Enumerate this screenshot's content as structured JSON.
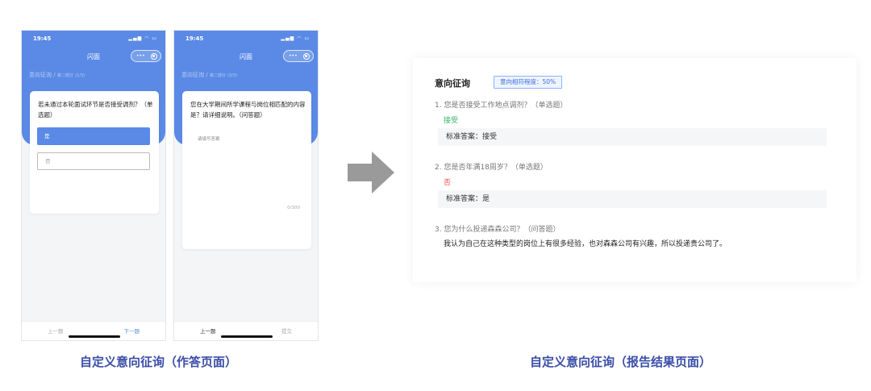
{
  "phone_answer_single": {
    "status_time": "19:45",
    "nav_title": "闪面",
    "breadcrumb": {
      "section": "意向征询",
      "separator": "/",
      "part": "第二部分",
      "progress": "(1/3)"
    },
    "question": "若未通过本轮面试环节是否接受调剂？（单选题）",
    "options": [
      {
        "label": "是",
        "selected": true
      },
      {
        "label": "否",
        "selected": false
      }
    ],
    "bottom": {
      "prev": "上一题",
      "next": "下一题"
    }
  },
  "phone_answer_text": {
    "status_time": "19:45",
    "nav_title": "闪面",
    "breadcrumb": {
      "section": "意向征询",
      "separator": "/",
      "part": "第二部分",
      "progress": "(3/3)"
    },
    "question": "您在大学期间所学课程与岗位相匹配的内容是？请详细说明。（问答题）",
    "placeholder": "请填写答案",
    "char_count": "0/300",
    "bottom": {
      "prev": "上一题",
      "submit": "提交"
    }
  },
  "report": {
    "title": "意向征询",
    "match_badge": "意向相符程度：50%",
    "items": [
      {
        "question": "1. 您是否接受工作地点调剂？（单选题）",
        "answer": "接受",
        "standard": "标准答案：接受"
      },
      {
        "question": "2. 您是否年满18周岁？（单选题）",
        "answer": "否",
        "standard": "标准答案：是"
      },
      {
        "question": "3. 您为什么投递森森公司？（问答题）",
        "answer": "我认为自己在这种类型的岗位上有很多经验，也对森森公司有兴趣，所以投递贵公司了。"
      }
    ]
  },
  "captions": {
    "left": "自定义意向征询（作答页面）",
    "right": "自定义意向征询（报告结果页面）"
  },
  "colors": {
    "primary": "#5b8ae6",
    "caption": "#3b4ea8",
    "answer_match": "#38b36a",
    "answer_mismatch": "#e5534b",
    "arrow": "#9a9a9a"
  },
  "icons": [
    "signal-icon",
    "wifi-icon",
    "battery-icon",
    "more-dots-icon",
    "target-icon",
    "right-arrow-icon"
  ]
}
